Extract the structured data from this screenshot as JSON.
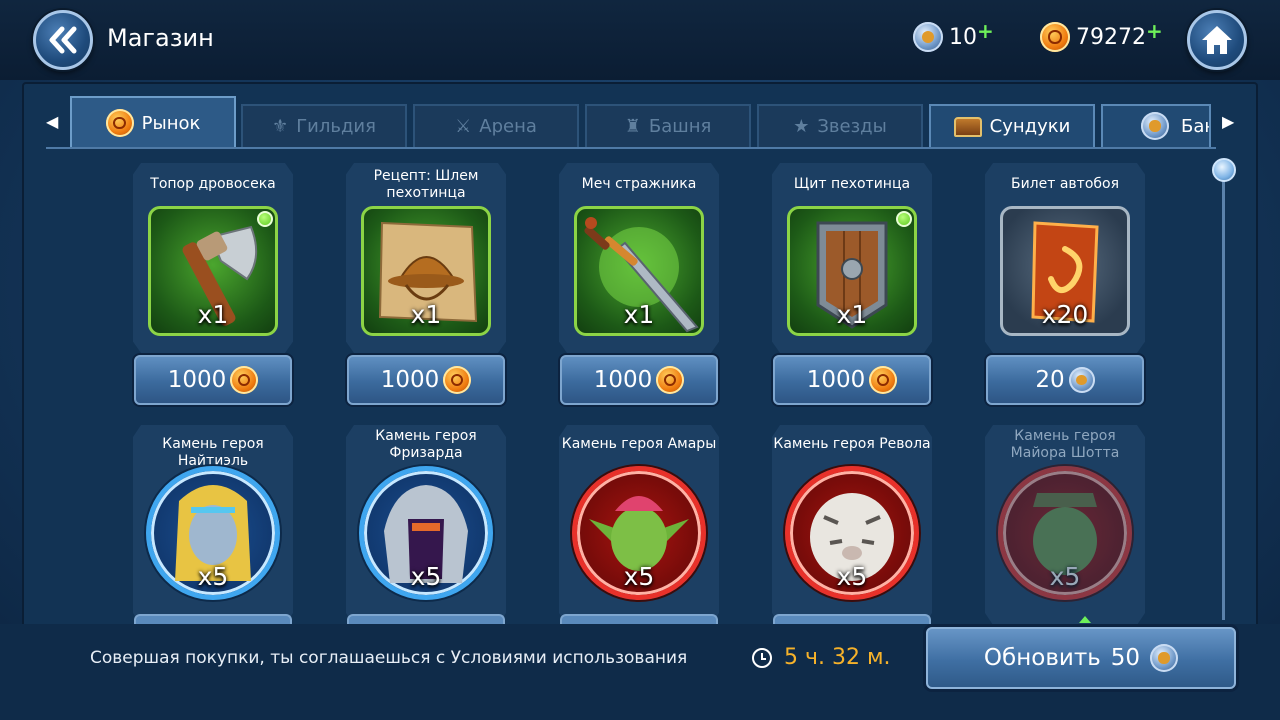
{
  "header": {
    "title": "Магазин",
    "gems": "10",
    "gems_plus": "+",
    "gold": "79272",
    "gold_plus": "+"
  },
  "tabs": [
    {
      "label": "Рынок",
      "icon": "coin-icon"
    },
    {
      "label": "Гильдия",
      "icon": "guild-icon"
    },
    {
      "label": "Арена",
      "icon": "arena-icon"
    },
    {
      "label": "Башня",
      "icon": "tower-icon"
    },
    {
      "label": "Звезды",
      "icon": "star-icon"
    },
    {
      "label": "Сундуки",
      "icon": "chest-icon"
    },
    {
      "label": "Бан",
      "icon": "gem-icon"
    }
  ],
  "items": [
    {
      "name": "Топор дровосека",
      "qty": "x1",
      "price": "1000",
      "currency": "gold",
      "icon": "axe-icon"
    },
    {
      "name": "Рецепт: Шлем пехотинца",
      "qty": "x1",
      "price": "1000",
      "currency": "gold",
      "icon": "helmet-recipe-icon"
    },
    {
      "name": "Меч стражника",
      "qty": "x1",
      "price": "1000",
      "currency": "gold",
      "icon": "sword-icon"
    },
    {
      "name": "Щит пехотинца",
      "qty": "x1",
      "price": "1000",
      "currency": "gold",
      "icon": "shield-icon"
    },
    {
      "name": "Билет автобоя",
      "qty": "x20",
      "price": "20",
      "currency": "gems",
      "icon": "autobattle-ticket-icon"
    }
  ],
  "heroes": [
    {
      "name": "Камень героя Найтиэль",
      "qty": "x5",
      "frame": "blue"
    },
    {
      "name": "Камень героя Фризарда",
      "qty": "x5",
      "frame": "blue"
    },
    {
      "name": "Камень героя Амары",
      "qty": "x5",
      "frame": "red"
    },
    {
      "name": "Камень героя Револа",
      "qty": "x5",
      "frame": "red"
    },
    {
      "name": "Камень героя Майора Шотта",
      "qty": "x5",
      "frame": "red"
    }
  ],
  "footer": {
    "terms": "Совершая покупки, ты соглашаешься с Условиями использования",
    "timer": "5 ч. 32 м.",
    "refresh_label": "Обновить",
    "refresh_cost": "50"
  },
  "colors": {
    "accent_gold": "#f6b22a",
    "green_frame": "#8cd446",
    "panel": "#123354"
  }
}
